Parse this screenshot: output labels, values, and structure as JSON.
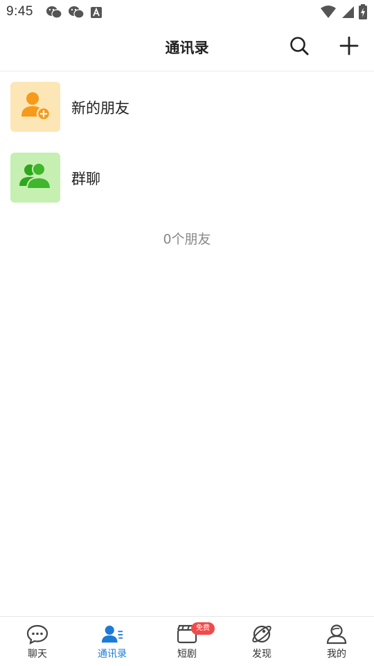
{
  "status_bar": {
    "time": "9:45",
    "left_icons": [
      "wechat-icon",
      "wechat-icon",
      "a-icon"
    ],
    "right_icons": [
      "wifi-icon",
      "signal-icon",
      "battery-charging-icon"
    ]
  },
  "header": {
    "title": "通讯录",
    "actions": [
      "search-icon",
      "plus-icon"
    ]
  },
  "list": {
    "items": [
      {
        "label": "新的朋友",
        "icon": "add-friend-icon",
        "icon_bg": "#fde6b6",
        "icon_color": "#f59a1b"
      },
      {
        "label": "群聊",
        "icon": "group-chat-icon",
        "icon_bg": "#c6f0b1",
        "icon_color": "#3fb62c"
      }
    ]
  },
  "friend_count": "0个朋友",
  "tabbar": {
    "active_color": "#1d7bd8",
    "tabs": [
      {
        "label": "聊天",
        "icon": "chat-bubble-icon",
        "active": false
      },
      {
        "label": "通讯录",
        "icon": "contacts-icon",
        "active": true
      },
      {
        "label": "短剧",
        "icon": "clapperboard-icon",
        "active": false,
        "badge": "免费"
      },
      {
        "label": "发现",
        "icon": "planet-icon",
        "active": false
      },
      {
        "label": "我的",
        "icon": "profile-icon",
        "active": false
      }
    ]
  }
}
